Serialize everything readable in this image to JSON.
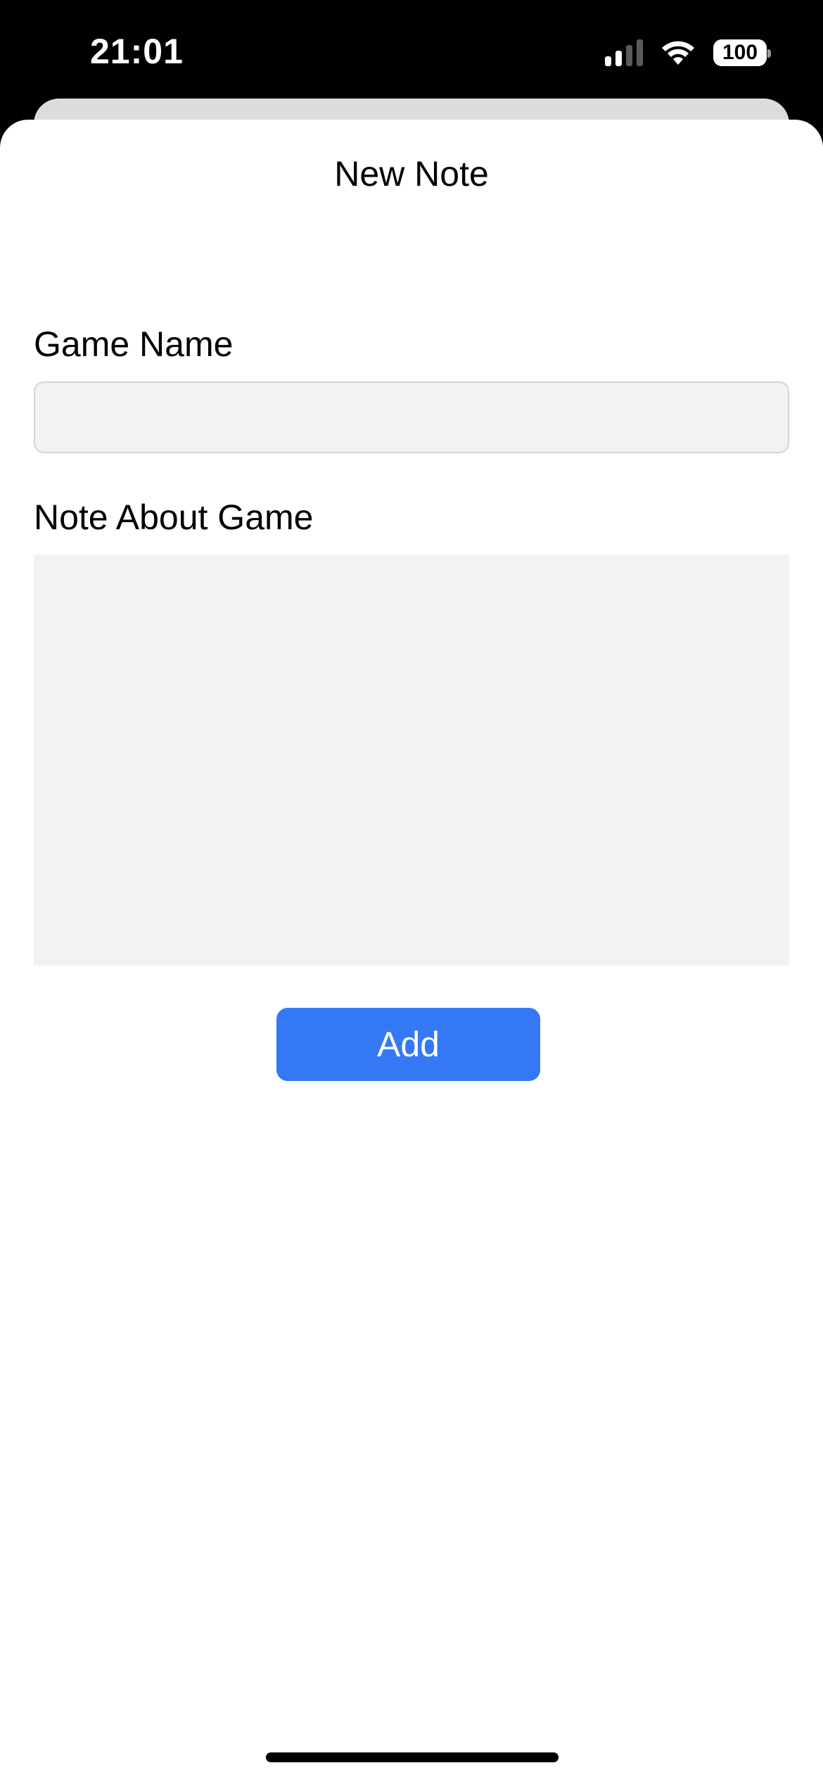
{
  "status_bar": {
    "time": "21:01",
    "battery": "100",
    "signal_icon": "cellular-signal-icon",
    "wifi_icon": "wifi-icon",
    "battery_icon": "battery-icon"
  },
  "sheet": {
    "title": "New Note"
  },
  "form": {
    "game_name_label": "Game Name",
    "game_name_value": "",
    "game_name_placeholder": "",
    "note_label": "Note About Game",
    "note_value": "",
    "note_placeholder": ""
  },
  "actions": {
    "add_label": "Add"
  },
  "colors": {
    "accent": "#3478f6",
    "field_background": "#f2f2f2",
    "status_bar_background": "#000000",
    "signal_active": "#ffffff",
    "signal_inactive": "#5a5a5a"
  }
}
